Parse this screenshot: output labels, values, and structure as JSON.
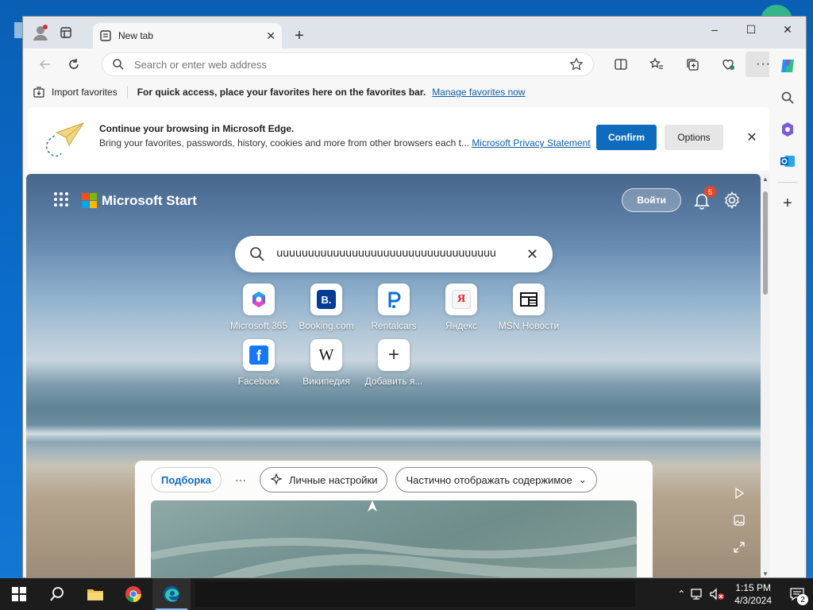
{
  "browser": {
    "tab": {
      "title": "New tab",
      "close_icon": "close-icon"
    },
    "window_controls": {
      "minimize": "–",
      "maximize": "☐",
      "close": "✕"
    },
    "address_bar": {
      "placeholder": "Search or enter web address",
      "value": ""
    },
    "favorites_bar": {
      "import_label": "Import favorites",
      "message": "For quick access, place your favorites here on the favorites bar.",
      "manage_link": "Manage favorites now"
    },
    "banner": {
      "title": "Continue your browsing in Microsoft Edge.",
      "body": "Bring your favorites, passwords, history, cookies and more from other browsers each t...",
      "privacy_link": "Microsoft Privacy Statement",
      "confirm_label": "Confirm",
      "options_label": "Options"
    }
  },
  "start_page": {
    "brand": "Microsoft Start",
    "signin_label": "Войти",
    "notification_count": "5",
    "search": {
      "value": "uuuuuuuuuuuuuuuuuuuuuuuuuuuuuuuuuuu"
    },
    "quick_links": [
      {
        "label": "Microsoft 365",
        "icon": "microsoft365-icon"
      },
      {
        "label": "Booking.com",
        "icon": "booking-icon"
      },
      {
        "label": "Rentalcars",
        "icon": "rentalcars-icon"
      },
      {
        "label": "Яндекс",
        "icon": "yandex-icon"
      },
      {
        "label": "MSN Новости",
        "icon": "msn-news-icon"
      },
      {
        "label": "Facebook",
        "icon": "facebook-icon"
      },
      {
        "label": "Википедия",
        "icon": "wikipedia-icon"
      },
      {
        "label": "Добавить я...",
        "icon": "add-icon"
      }
    ],
    "feed": {
      "tab_selected": "Подборка",
      "more": "···",
      "personalize_label": "Личные настройки",
      "content_mode_label": "Частично отображать содержимое"
    }
  },
  "taskbar": {
    "time": "1:15 PM",
    "date": "4/3/2024",
    "notification_count": "2"
  },
  "colors": {
    "accent": "#0f6cbd",
    "taskbar": "#1c1c1c",
    "badge": "#e3472a"
  }
}
